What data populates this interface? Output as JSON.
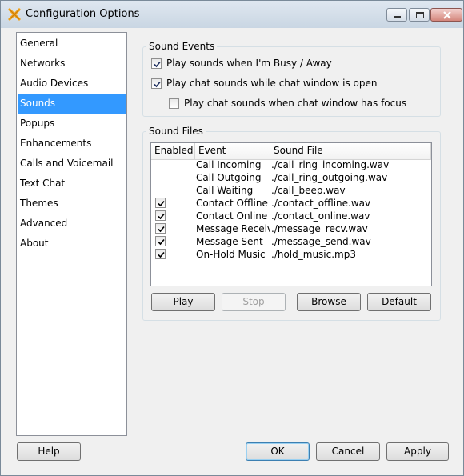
{
  "window": {
    "title": "Configuration Options"
  },
  "sidebar": {
    "items": [
      {
        "label": "General"
      },
      {
        "label": "Networks"
      },
      {
        "label": "Audio Devices"
      },
      {
        "label": "Sounds"
      },
      {
        "label": "Popups"
      },
      {
        "label": "Enhancements"
      },
      {
        "label": "Calls and Voicemail"
      },
      {
        "label": "Text Chat"
      },
      {
        "label": "Themes"
      },
      {
        "label": "Advanced"
      },
      {
        "label": "About"
      }
    ],
    "selected": "Sounds"
  },
  "sound_events": {
    "title": "Sound Events",
    "options": [
      {
        "label": "Play sounds when I'm Busy / Away",
        "checked": true
      },
      {
        "label": "Play chat sounds while chat window is open",
        "checked": true
      },
      {
        "label": "Play chat sounds when chat window has focus",
        "checked": false
      }
    ]
  },
  "sound_files": {
    "title": "Sound Files",
    "columns": [
      "Enabled",
      "Event",
      "Sound File"
    ],
    "rows": [
      {
        "enabled": false,
        "event": "Call Incoming",
        "file": "./call_ring_incoming.wav"
      },
      {
        "enabled": false,
        "event": "Call Outgoing",
        "file": "./call_ring_outgoing.wav"
      },
      {
        "enabled": false,
        "event": "Call Waiting",
        "file": "./call_beep.wav"
      },
      {
        "enabled": true,
        "event": "Contact Offline",
        "file": "./contact_offline.wav"
      },
      {
        "enabled": true,
        "event": "Contact Online",
        "file": "./contact_online.wav"
      },
      {
        "enabled": true,
        "event": "Message Received",
        "file": "./message_recv.wav"
      },
      {
        "enabled": true,
        "event": "Message Sent",
        "file": "./message_send.wav"
      },
      {
        "enabled": true,
        "event": "On-Hold Music",
        "file": "./hold_music.mp3"
      }
    ],
    "buttons": {
      "play": "Play",
      "stop": "Stop",
      "browse": "Browse",
      "default": "Default"
    }
  },
  "footer": {
    "help": "Help",
    "ok": "OK",
    "cancel": "Cancel",
    "apply": "Apply"
  },
  "colors": {
    "selection": "#3399ff",
    "accent": "#f3a51c"
  }
}
